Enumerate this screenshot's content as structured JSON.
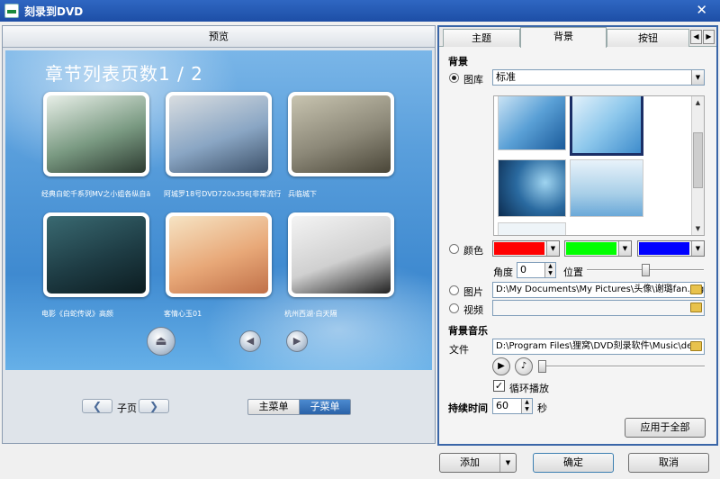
{
  "window": {
    "title": "刻录到DVD",
    "close_glyph": "✕"
  },
  "preview": {
    "header": "预览",
    "chapter_title": "章节列表页数1 / 2",
    "thumbnails": [
      {
        "caption": "经典白蛇千系列MV之小姐各纵自ā",
        "colors": [
          "#e8efe8",
          "#7a9a82",
          "#2c3a30"
        ]
      },
      {
        "caption": "阿城罗18号DVD720x356[非常流行",
        "colors": [
          "#d9dde0",
          "#8aa6c4",
          "#3c5068"
        ]
      },
      {
        "caption": "兵临城下",
        "colors": [
          "#c8c4b0",
          "#8c8878",
          "#4a4638"
        ]
      },
      {
        "caption": "电影《白蛇传说》高颜",
        "colors": [
          "#3a6a72",
          "#1e3c44",
          "#0c1c20"
        ]
      },
      {
        "caption": "客情心玉01",
        "colors": [
          "#f6e4c4",
          "#e8a878",
          "#c07048"
        ]
      },
      {
        "caption": "杭州西湖·白天隔",
        "colors": [
          "#f4f4f4",
          "#d0d0d0",
          "#222222"
        ]
      }
    ],
    "nav_icons": [
      "eject-icon",
      "arrow-left-icon",
      "arrow-right-icon"
    ],
    "page_label": "子页",
    "prev_glyph": "❮",
    "next_glyph": "❯",
    "main_menu": "主菜单",
    "sub_menu": "子菜单"
  },
  "panel": {
    "tabs": [
      "主题",
      "背景",
      "按钮"
    ],
    "active_tab": "背景",
    "bg_section": "背景",
    "gallery_label": "图库",
    "gallery_select": "标准",
    "color_label": "颜色",
    "colors": [
      "#ff0000",
      "#00ff00",
      "#0000ff"
    ],
    "angle_label": "角度",
    "angle_value": "0",
    "position_label": "位置",
    "position_fraction": 0.5,
    "image_label": "图片",
    "image_path": "D:\\My Documents\\My Pictures\\头像\\谢璐fan.jpg",
    "video_label": "视频",
    "video_path": "",
    "music_section": "背景音乐",
    "file_label": "文件",
    "file_path": "D:\\Program Files\\狸窝\\DVD刻录软件\\Music\\defa",
    "loop_label": "循环播放",
    "duration_label": "持续时间",
    "duration_value": "60",
    "duration_unit": "秒",
    "apply_all": "应用于全部"
  },
  "footer": {
    "add": "添加",
    "ok": "确定",
    "cancel": "取消"
  }
}
